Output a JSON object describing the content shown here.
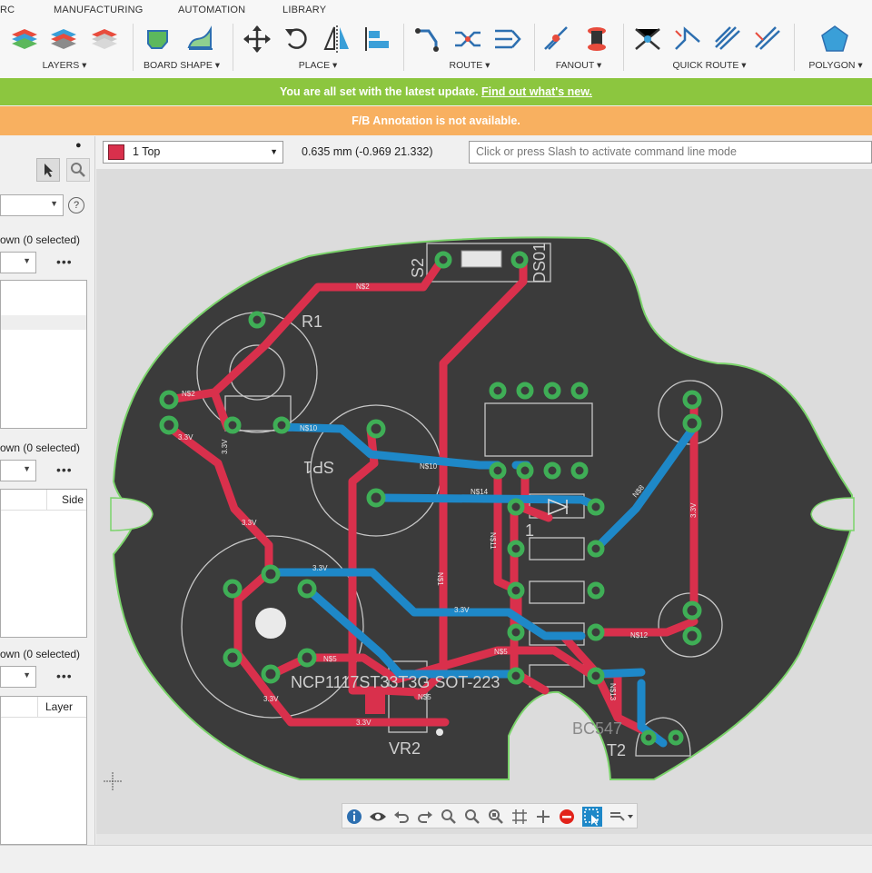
{
  "toolbar": {
    "tabs": [
      "RC",
      "MANUFACTURING",
      "AUTOMATION",
      "LIBRARY"
    ],
    "groups": {
      "layers": "LAYERS ▾",
      "board_shape": "BOARD SHAPE ▾",
      "place": "PLACE ▾",
      "route": "ROUTE ▾",
      "fanout": "FANOUT ▾",
      "quick_route": "QUICK ROUTE ▾",
      "polygon": "POLYGON ▾"
    }
  },
  "banners": {
    "update_text": "You are all set with the latest update.",
    "update_link": "Find out what's new.",
    "annotation": "F/B Annotation is not available."
  },
  "left_panel": {
    "shown1": "own (0 selected)",
    "shown2": "own (0 selected)",
    "shown3": "own (0 selected)",
    "dots": "•••",
    "col_side": "Side",
    "col_layer": "Layer",
    "help": "?"
  },
  "command_bar": {
    "layer": "1 Top",
    "coordinates": "0.635 mm (-0.969 21.332)",
    "command_placeholder": "Click or press Slash to activate command line mode"
  },
  "board": {
    "labels": {
      "r1": "R1",
      "ncp": "NCP1117ST33T3G SOT-223",
      "vr2": "VR2",
      "bc547": "BC547",
      "t2": "T2",
      "ic_u": "1",
      "ds01": "DS01",
      "sp1": "SP1",
      "s2": "S2"
    },
    "nets": [
      "N$2",
      "N$1",
      "N$12",
      "N$10",
      "N$14",
      "N$11",
      "N$5",
      "N$13",
      "N$8",
      "3.3V"
    ],
    "colors": {
      "top": "#d9304c",
      "bottom": "#1e88c8",
      "board": "#3b3b3b",
      "pad": "#3fae56",
      "outline": "#7bd36b"
    }
  }
}
